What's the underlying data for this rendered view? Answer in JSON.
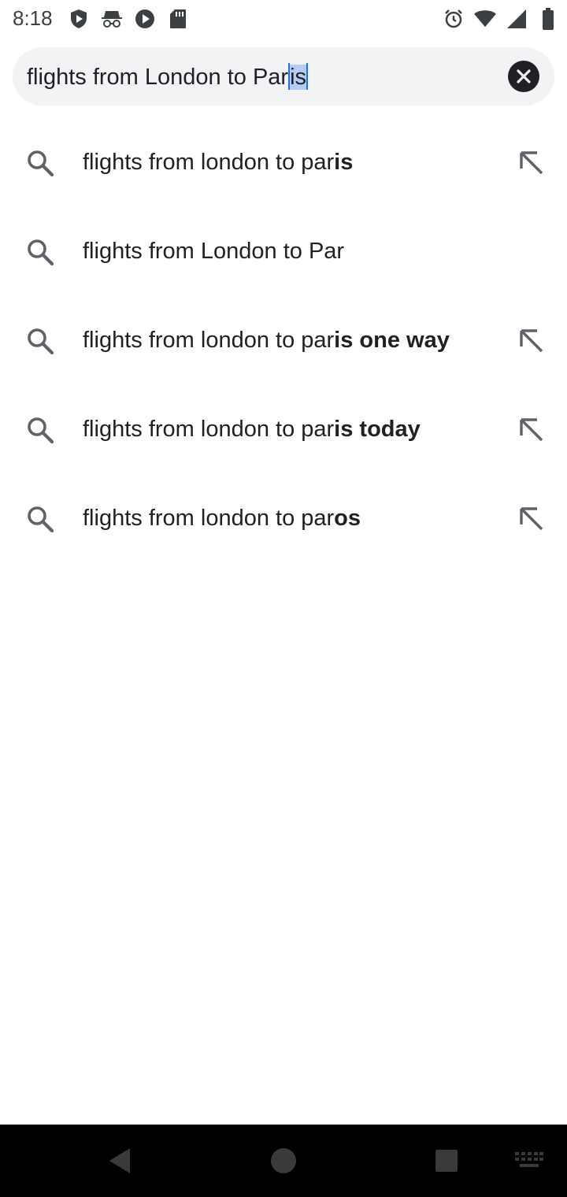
{
  "status_bar": {
    "time": "8:18",
    "left_icons": [
      "shield-play-icon",
      "incognito-icon",
      "play-protect-icon",
      "sd-card-icon"
    ],
    "right_icons": [
      "alarm-icon",
      "wifi-icon",
      "signal-icon",
      "battery-icon"
    ]
  },
  "search": {
    "query_prefix": "flights from London to Par",
    "query_selected": "is",
    "clear_icon": "close-icon"
  },
  "suggestions": [
    {
      "normal": "flights from london to par",
      "bold": "is",
      "has_arrow": true
    },
    {
      "normal": "flights from London to Par",
      "bold": "",
      "has_arrow": false
    },
    {
      "normal": "flights from london to par",
      "bold": "is one way",
      "has_arrow": true
    },
    {
      "normal": "flights from london to par",
      "bold": "is today",
      "has_arrow": true
    },
    {
      "normal": "flights from london to par",
      "bold": "os",
      "has_arrow": true
    }
  ],
  "nav_bar": {
    "buttons": [
      "back-icon",
      "home-icon",
      "recents-icon",
      "keyboard-icon"
    ]
  },
  "colors": {
    "search_bg": "#f1f3f4",
    "selection": "#b4cdf5",
    "caret": "#1a73e8",
    "icon_gray": "#5f6368"
  }
}
